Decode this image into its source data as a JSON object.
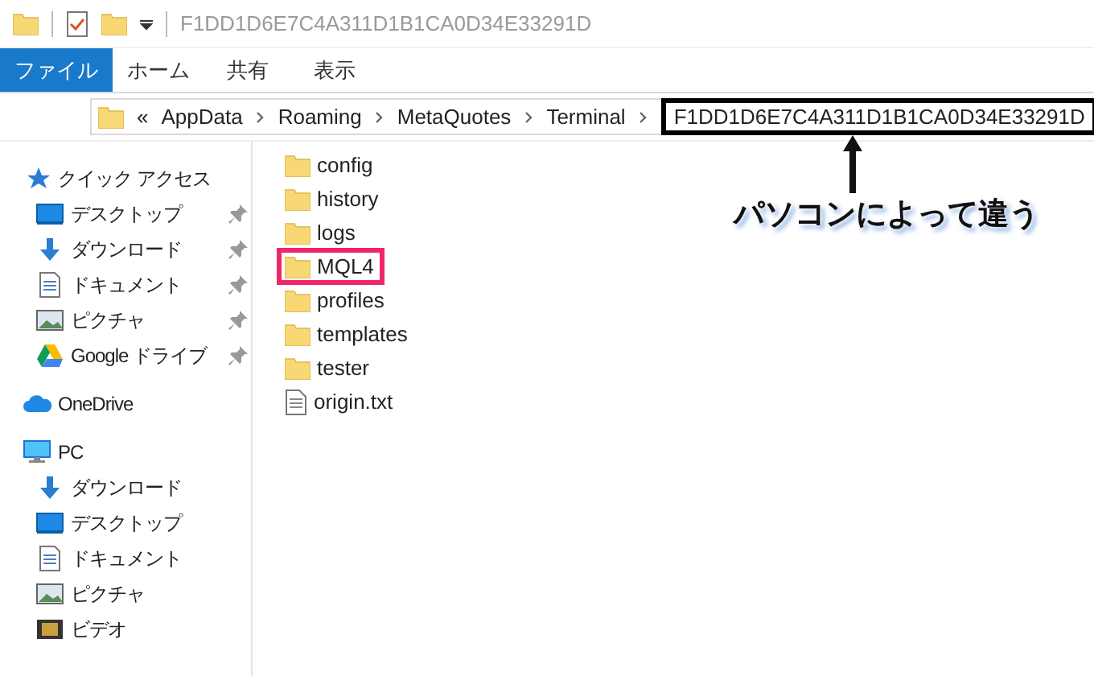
{
  "title_bar": {
    "title": "F1DD1D6E7C4A311D1B1CA0D34E33291D"
  },
  "ribbon": {
    "tabs": [
      {
        "label": "ファイル",
        "selected": true
      },
      {
        "label": "ホーム",
        "selected": false
      },
      {
        "label": "共有",
        "selected": false
      },
      {
        "label": "表示",
        "selected": false
      }
    ]
  },
  "address_bar": {
    "overflow": "«",
    "crumbs": [
      {
        "label": "AppData",
        "highlighted": false
      },
      {
        "label": "Roaming",
        "highlighted": false
      },
      {
        "label": "MetaQuotes",
        "highlighted": false
      },
      {
        "label": "Terminal",
        "highlighted": false
      },
      {
        "label": "F1DD1D6E7C4A311D1B1CA0D34E33291D",
        "highlighted": true
      }
    ]
  },
  "annotation": {
    "text": "パソコンによって違う"
  },
  "sidebar": {
    "sections": [
      {
        "label": "クイック アクセス",
        "kind": "star",
        "children": [
          {
            "label": "デスクトップ",
            "kind": "desktop",
            "pinned": true
          },
          {
            "label": "ダウンロード",
            "kind": "download",
            "pinned": true
          },
          {
            "label": "ドキュメント",
            "kind": "document",
            "pinned": true
          },
          {
            "label": "ピクチャ",
            "kind": "pictures",
            "pinned": true
          },
          {
            "label": "Google ドライブ",
            "kind": "drive",
            "pinned": true
          }
        ]
      },
      {
        "label": "OneDrive",
        "kind": "cloud"
      },
      {
        "label": "PC",
        "kind": "pc",
        "children": [
          {
            "label": "ダウンロード",
            "kind": "download",
            "pinned": false
          },
          {
            "label": "デスクトップ",
            "kind": "desktop",
            "pinned": false
          },
          {
            "label": "ドキュメント",
            "kind": "document",
            "pinned": false
          },
          {
            "label": "ピクチャ",
            "kind": "pictures",
            "pinned": false
          },
          {
            "label": "ビデオ",
            "kind": "video",
            "pinned": false
          }
        ]
      }
    ]
  },
  "files": [
    {
      "name": "config",
      "kind": "folder",
      "highlighted": false
    },
    {
      "name": "history",
      "kind": "folder",
      "highlighted": false
    },
    {
      "name": "logs",
      "kind": "folder",
      "highlighted": false
    },
    {
      "name": "MQL4",
      "kind": "folder",
      "highlighted": true
    },
    {
      "name": "profiles",
      "kind": "folder",
      "highlighted": false
    },
    {
      "name": "templates",
      "kind": "folder",
      "highlighted": false
    },
    {
      "name": "tester",
      "kind": "folder",
      "highlighted": false
    },
    {
      "name": "origin.txt",
      "kind": "text",
      "highlighted": false
    }
  ]
}
